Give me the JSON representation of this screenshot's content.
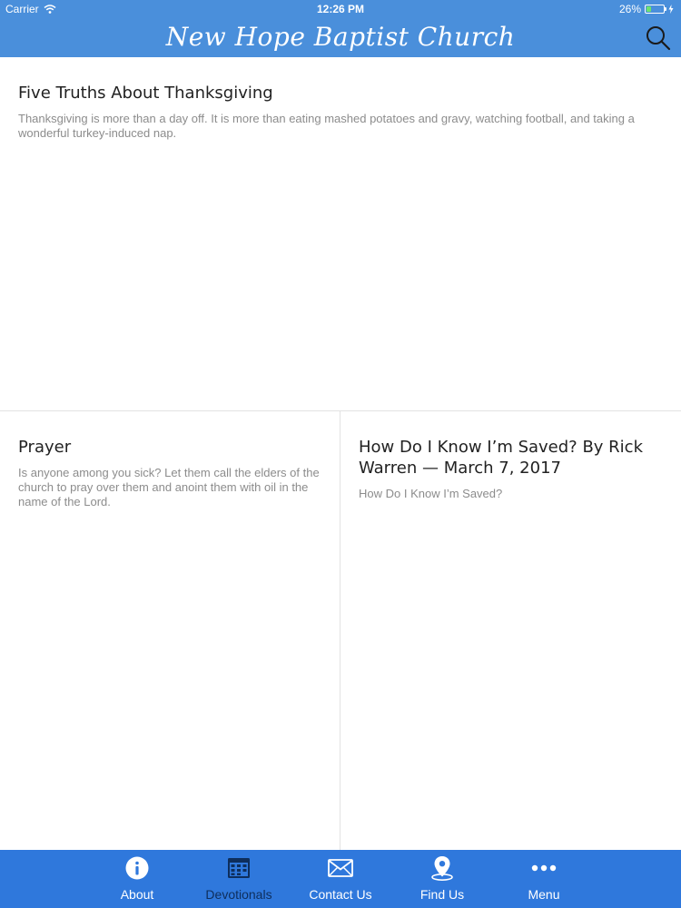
{
  "status_bar": {
    "carrier": "Carrier",
    "time": "12:26 PM",
    "battery": "26%",
    "battery_level": 0.26
  },
  "header": {
    "title": "New Hope Baptist Church",
    "search_icon": "search-icon"
  },
  "colors": {
    "header": "#4a8fdb",
    "tabbar": "#2f78dc",
    "active_tab_label": "#0e2e5c"
  },
  "devotionals": [
    {
      "title": "Five Truths About Thanksgiving",
      "description": "Thanksgiving is more than a day off. It is more than eating mashed potatoes and gravy, watching football, and taking a wonderful turkey-induced nap."
    },
    {
      "title": "Prayer",
      "description": "Is anyone among you sick? Let them call the elders of the church to pray over them and anoint them with oil in the name of the Lord."
    },
    {
      "title": "How Do I Know I’m Saved?  By Rick Warren — March 7, 2017",
      "description": "How Do I Know I’m Saved?"
    }
  ],
  "tabbar": {
    "active": "Devotionals",
    "tabs": [
      {
        "label": "About",
        "icon": "info-icon"
      },
      {
        "label": "Devotionals",
        "icon": "calendar-icon"
      },
      {
        "label": "Contact Us",
        "icon": "envelope-icon"
      },
      {
        "label": "Find Us",
        "icon": "map-pin-icon"
      },
      {
        "label": "Menu",
        "icon": "more-dots-icon"
      }
    ]
  }
}
